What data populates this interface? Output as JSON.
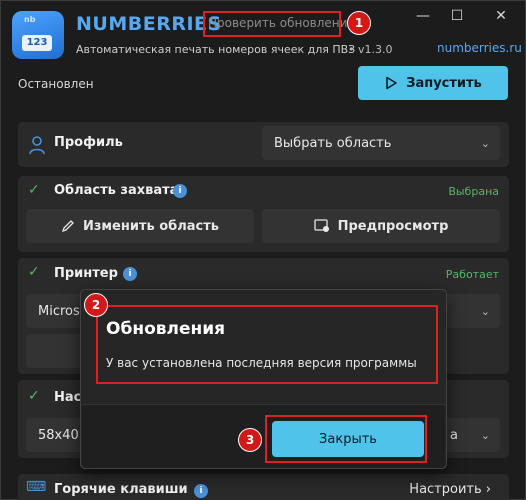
{
  "app": {
    "icon_badge": "nb",
    "icon_counter": "123",
    "title": "NUMBERRIES",
    "check_updates_label": "Проверить обновления",
    "subtitle": "Автоматическая печать номеров ячеек для ПВЗ",
    "version": "• v1.3.0",
    "site": "numberries.ru"
  },
  "window_controls": {
    "minimize": "—",
    "maximize": "☐",
    "close": "✕"
  },
  "status": "Остановлен",
  "run_button": "Запустить",
  "profile": {
    "title": "Профиль",
    "select_value": "Выбрать область"
  },
  "capture": {
    "title": "Область захвата",
    "status": "Выбрана",
    "edit_button": "Изменить область",
    "preview_button": "Предпросмотр"
  },
  "printer": {
    "title": "Принтер",
    "status": "Работает",
    "select_partial": "Microso"
  },
  "settings": {
    "title_partial": "Наст",
    "select_partial": "58x40 м",
    "right_partial": "а"
  },
  "hotkeys": {
    "title": "Горячие клавиши",
    "button": "Настроить"
  },
  "dialog": {
    "title": "Обновления",
    "message": "У вас установлена последняя версия программы",
    "close_button": "Закрыть"
  },
  "annotations": [
    "1",
    "2",
    "3"
  ],
  "colors": {
    "accent": "#4fc3ea",
    "brand": "#58a8f0",
    "ok": "#54b765",
    "highlight": "#e02020"
  }
}
